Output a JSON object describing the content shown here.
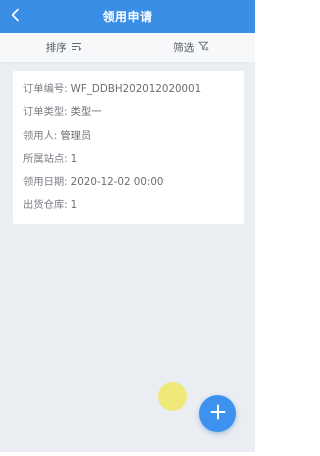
{
  "header": {
    "title": "领用申请",
    "back_icon": "chevron-left-icon"
  },
  "filter_bar": {
    "sort_label": "排序",
    "sort_icon": "sort-icon",
    "filter_label": "筛选",
    "filter_icon": "filter-icon"
  },
  "records": [
    {
      "fields": [
        {
          "label": "订单编号:",
          "value": "WF_DDBH202012020001"
        },
        {
          "label": "订单类型:",
          "value": "类型一"
        },
        {
          "label": "领用人:",
          "value": "管理员"
        },
        {
          "label": "所属站点:",
          "value": "1"
        },
        {
          "label": "领用日期:",
          "value": "2020-12-02 00:00"
        },
        {
          "label": "出货仓库:",
          "value": "1"
        }
      ]
    }
  ],
  "fab": {
    "icon": "plus-icon"
  },
  "colors": {
    "primary": "#3a8ee6",
    "fab": "#3d92ef",
    "background": "#eaedf2",
    "touch_indicator": "#eee86e"
  }
}
